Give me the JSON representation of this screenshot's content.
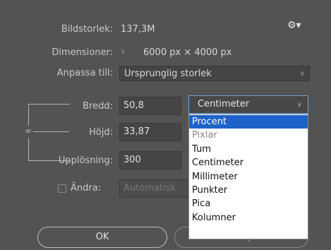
{
  "image_size": {
    "label": "Bildstorlek:",
    "value": "137,3M"
  },
  "gear_icon": "⚙▾",
  "dimensions": {
    "label": "Dimensioner:",
    "value": "6000 px  ×  4000 px"
  },
  "fit_to": {
    "label": "Anpassa till:",
    "value": "Ursprunglig storlek"
  },
  "width": {
    "label": "Bredd:",
    "value": "50,8",
    "unit": "Centimeter"
  },
  "height": {
    "label": "Höjd:",
    "value": "33,87"
  },
  "resolution": {
    "label": "Upplösning:",
    "value": "300"
  },
  "resample": {
    "label": "Ändra:",
    "value": "Automatisk"
  },
  "unit_menu": {
    "items": [
      "Procent",
      "Pixlar",
      "Tum",
      "Centimeter",
      "Millimeter",
      "Punkter",
      "Pica",
      "Kolumner"
    ]
  },
  "buttons": {
    "ok": "OK",
    "cancel": "Avbryt"
  },
  "colors": {
    "background": "#535353",
    "selection": "#1f62c9",
    "focus_border": "#6aa0d8"
  }
}
